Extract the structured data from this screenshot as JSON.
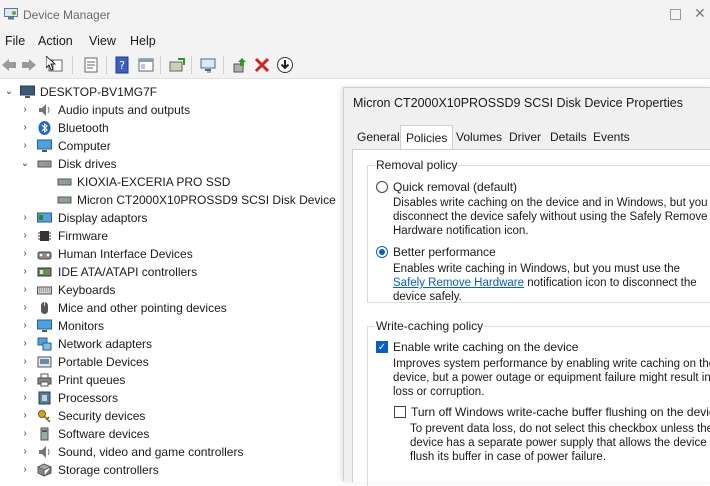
{
  "window": {
    "title": "Device Manager"
  },
  "menu": [
    "File",
    "Action",
    "View",
    "Help"
  ],
  "tree": {
    "root": "DESKTOP-BV1MG7F",
    "items": [
      {
        "label": "Audio inputs and outputs",
        "icon": "speaker-icon"
      },
      {
        "label": "Bluetooth",
        "icon": "bluetooth-icon"
      },
      {
        "label": "Computer",
        "icon": "computer-icon"
      },
      {
        "label": "Disk drives",
        "icon": "disk-drive-icon",
        "expanded": true,
        "children": [
          "KIOXIA-EXCERIA PRO SSD",
          "Micron CT2000X10PROSSD9 SCSI Disk Device"
        ]
      },
      {
        "label": "Display adaptors",
        "icon": "display-adapter-icon"
      },
      {
        "label": "Firmware",
        "icon": "firmware-icon"
      },
      {
        "label": "Human Interface Devices",
        "icon": "hid-icon"
      },
      {
        "label": "IDE ATA/ATAPI controllers",
        "icon": "ide-controller-icon"
      },
      {
        "label": "Keyboards",
        "icon": "keyboard-icon"
      },
      {
        "label": "Mice and other pointing devices",
        "icon": "mouse-icon"
      },
      {
        "label": "Monitors",
        "icon": "monitor-icon"
      },
      {
        "label": "Network adapters",
        "icon": "network-adapter-icon"
      },
      {
        "label": "Portable Devices",
        "icon": "portable-device-icon"
      },
      {
        "label": "Print queues",
        "icon": "printer-icon"
      },
      {
        "label": "Processors",
        "icon": "processor-icon"
      },
      {
        "label": "Security devices",
        "icon": "security-key-icon"
      },
      {
        "label": "Software devices",
        "icon": "software-device-icon"
      },
      {
        "label": "Sound, video and game controllers",
        "icon": "sound-controller-icon"
      },
      {
        "label": "Storage controllers",
        "icon": "storage-controller-icon"
      }
    ]
  },
  "dialog": {
    "title": "Micron CT2000X10PROSSD9 SCSI Disk Device Properties",
    "tabs": [
      "General",
      "Policies",
      "Volumes",
      "Driver",
      "Details",
      "Events"
    ],
    "active_tab": "Policies",
    "removal": {
      "title": "Removal policy",
      "quick_label": "Quick removal (default)",
      "quick_desc": [
        "Disables write caching on the device and in Windows, but you can",
        "disconnect the device safely without using the Safely Remove",
        "Hardware notification icon."
      ],
      "better_label": "Better performance",
      "better_desc_1": "Enables write caching in Windows, but you must use the",
      "better_desc_link": "Safely Remove Hardware",
      "better_desc_2": " notification icon to disconnect the",
      "better_desc_3": "device safely.",
      "selected": "better"
    },
    "write_caching": {
      "title": "Write-caching policy",
      "enable_label": "Enable write caching on the device",
      "enable_checked": true,
      "enable_desc": [
        "Improves system performance by enabling write caching on the",
        "device, but a power outage or equipment failure might result in data",
        "loss or corruption."
      ],
      "flush_label": "Turn off Windows write-cache buffer flushing on the device",
      "flush_checked": false,
      "flush_desc": [
        "To prevent data loss, do not select this checkbox unless the",
        "device has a separate power supply that allows the device to",
        "flush its buffer in case of power failure."
      ]
    }
  },
  "colors": {
    "accent": "#0a5ccc",
    "titlebar": "#f3f3f3",
    "dialog_bg": "#f0f0f0"
  }
}
